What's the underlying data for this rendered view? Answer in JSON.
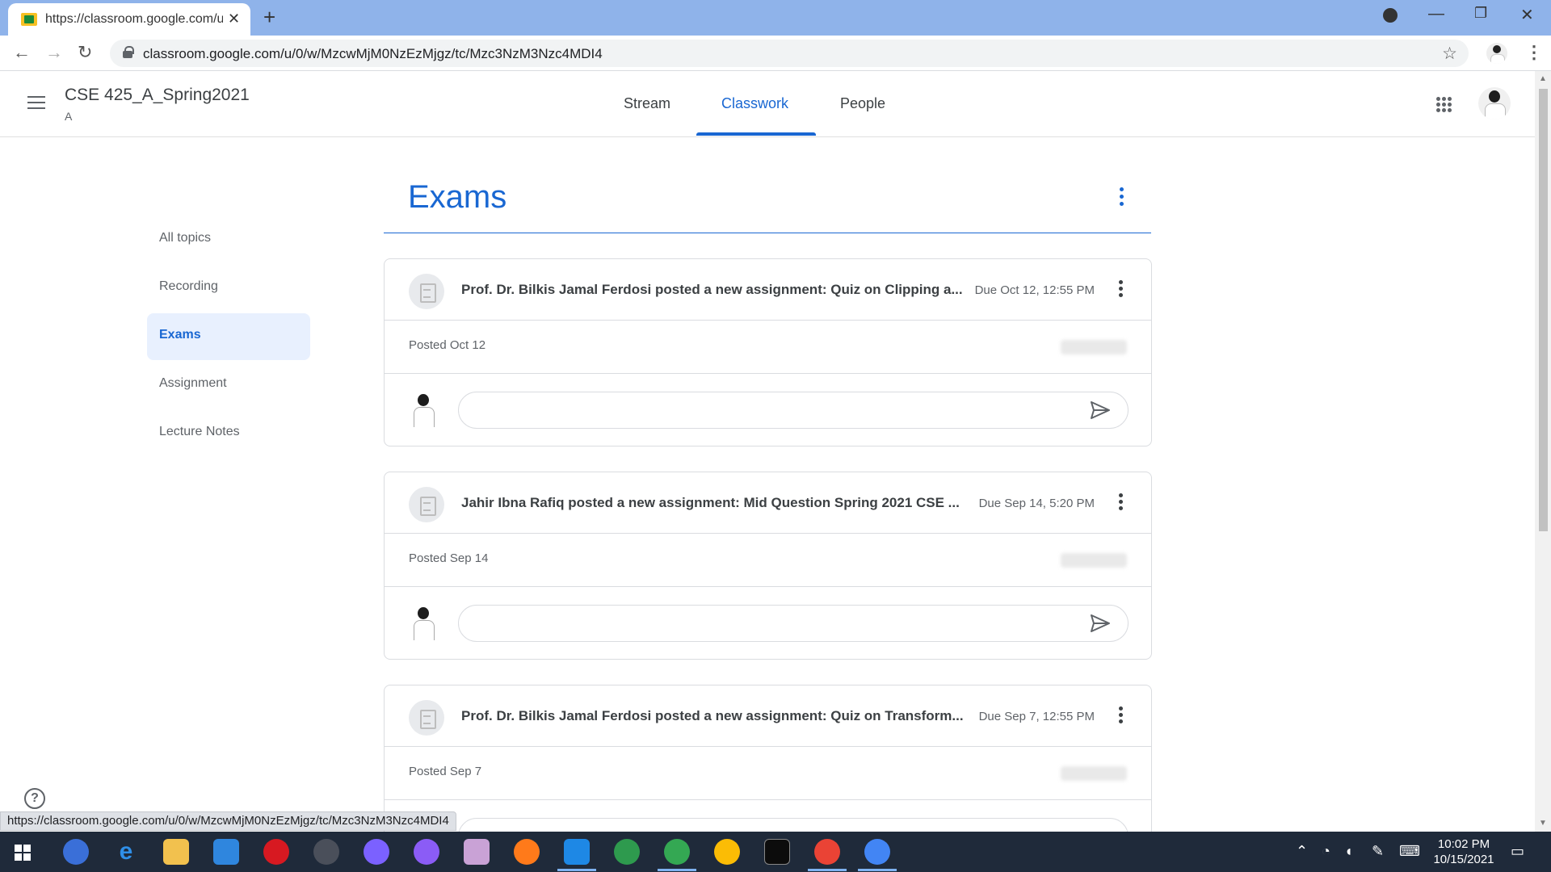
{
  "browser": {
    "tab_title": "https://classroom.google.com/u/",
    "url": "classroom.google.com/u/0/w/MzcwMjM0NzEzMjgz/tc/Mzc3NzM3Nzc4MDI4",
    "status_url": "https://classroom.google.com/u/0/w/MzcwMjM0NzEzMjgz/tc/Mzc3NzM3Nzc4MDI4"
  },
  "header": {
    "class_name": "CSE 425_A_Spring2021",
    "section": "A",
    "tabs": [
      "Stream",
      "Classwork",
      "People"
    ],
    "active_tab": "Classwork"
  },
  "sidebar": {
    "topics": [
      "All topics",
      "Recording",
      "Exams",
      "Assignment",
      "Lecture Notes"
    ],
    "active_topic": "Exams"
  },
  "topic": {
    "title": "Exams"
  },
  "cards": [
    {
      "title": "Prof. Dr. Bilkis Jamal Ferdosi posted a new assignment: Quiz on Clipping a...",
      "due": "Due Oct 12, 12:55 PM",
      "posted": "Posted Oct 12"
    },
    {
      "title": "Jahir Ibna Rafiq posted a new assignment: Mid Question Spring 2021 CSE ...",
      "due": "Due Sep 14, 5:20 PM",
      "posted": "Posted Sep 14"
    },
    {
      "title": "Prof. Dr. Bilkis Jamal Ferdosi posted a new assignment: Quiz on Transform...",
      "due": "Due Sep 7, 12:55 PM",
      "posted": "Posted Sep 7"
    }
  ],
  "taskbar": {
    "time": "10:02 PM",
    "date": "10/15/2021"
  },
  "colors": {
    "accent": "#1967d2",
    "active_topic_bg": "#e8f0fe",
    "tabbar": "#8fb3ea",
    "taskbar": "#1f2a3a"
  }
}
